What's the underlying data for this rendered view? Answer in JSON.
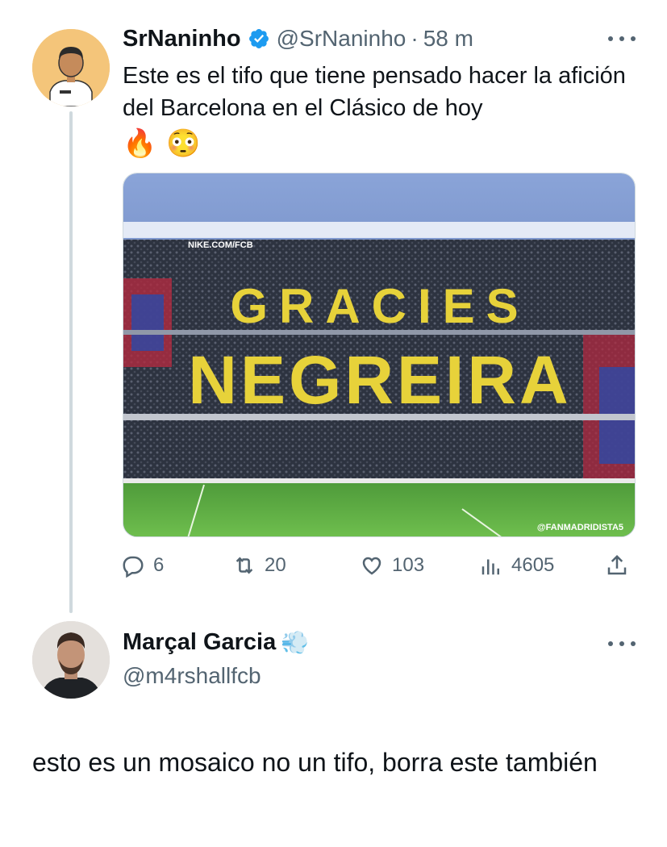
{
  "tweet": {
    "author_name": "SrNaninho",
    "handle": "@SrNaninho",
    "separator": "·",
    "time": "58 m",
    "text": "Este es el tifo que tiene pensado hacer la afición del Barcelona en el Clásico de hoy",
    "emojis": [
      "🔥",
      "😳"
    ],
    "media": {
      "banner_top": "NIKE.COM/FCB",
      "mosaic_line1": "GRACIES",
      "mosaic_line2": "NEGREIRA",
      "watermark": "@FANMADRIDISTA5"
    },
    "actions": {
      "replies": "6",
      "retweets": "20",
      "likes": "103",
      "views": "4605"
    }
  },
  "reply": {
    "author_name": "Marçal Garcia",
    "name_emoji": "💨",
    "handle": "@m4rshallfcb",
    "text": "esto es un mosaico no un tifo, borra este también"
  },
  "colors": {
    "text": "#0f1419",
    "secondary": "#536471",
    "verified": "#1d9bf0",
    "thread_line": "#cfd9de"
  }
}
